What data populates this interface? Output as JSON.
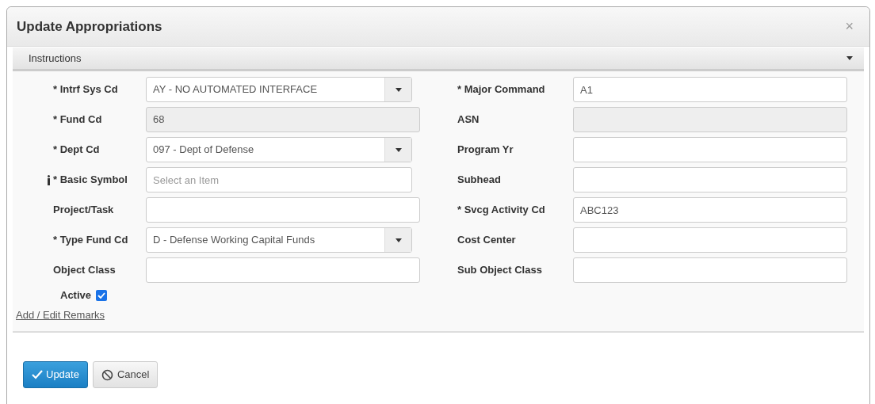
{
  "dialog": {
    "title": "Update Appropriations",
    "close": "×"
  },
  "instructions": {
    "label": "Instructions",
    "expanded": false
  },
  "left_fields": [
    {
      "label": "* Intrf Sys Cd",
      "kind": "select",
      "value": "AY - NO AUTOMATED INTERFACE",
      "info": false
    },
    {
      "label": "* Fund Cd",
      "kind": "readonly",
      "value": "68",
      "info": false
    },
    {
      "label": "* Dept Cd",
      "kind": "select",
      "value": "097 - Dept of Defense",
      "info": false
    },
    {
      "label": "* Basic Symbol",
      "kind": "lookup",
      "placeholder": "Select an Item",
      "info": true
    },
    {
      "label": "Project/Task",
      "kind": "text",
      "info": false
    },
    {
      "label": "* Type Fund Cd",
      "kind": "select",
      "value": "D - Defense Working Capital Funds",
      "info": false
    },
    {
      "label": "Object Class",
      "kind": "text",
      "info": false
    }
  ],
  "active": {
    "label": "Active",
    "checked": true
  },
  "right_fields": [
    {
      "label": "* Major Command",
      "kind": "text",
      "value": "A1"
    },
    {
      "label": "ASN",
      "kind": "readonly"
    },
    {
      "label": "Program Yr",
      "kind": "text"
    },
    {
      "label": "Subhead",
      "kind": "text"
    },
    {
      "label": "* Svcg Activity Cd",
      "kind": "text",
      "value": "ABC123"
    },
    {
      "label": "Cost Center",
      "kind": "text"
    },
    {
      "label": "Sub Object Class",
      "kind": "text"
    }
  ],
  "remarks_link": "Add / Edit Remarks",
  "buttons": [
    {
      "label": "Update",
      "kind": "primary"
    },
    {
      "label": "Cancel",
      "kind": "secondary"
    }
  ]
}
